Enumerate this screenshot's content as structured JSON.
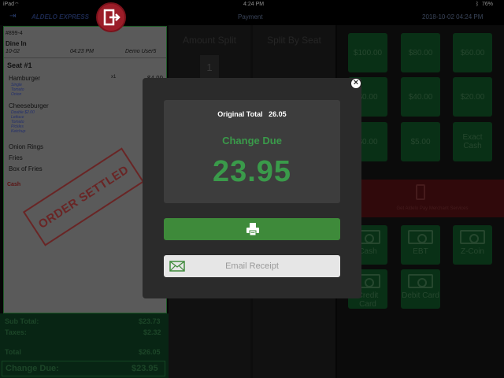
{
  "status": {
    "carrier": "iPad",
    "time": "4:24 PM",
    "battery": "76%"
  },
  "header": {
    "brand": "ALDELO EXPRESS",
    "screen_title": "Payment",
    "datetime": "2018-10-02 04:24 PM"
  },
  "ticket": {
    "order_no": "#899-4",
    "order_type": "Dine In",
    "date": "10-02",
    "time": "04:23 PM",
    "user": "Demo User5",
    "seat": "Seat #1",
    "items": [
      {
        "name": "Hamburger",
        "qty": "x1",
        "price": "$4.99",
        "mods": [
          "Single",
          "Tomato",
          "Onion"
        ]
      },
      {
        "name": "Cheeseburger",
        "qty": "",
        "price": "",
        "mods": [
          "Double $2.00",
          "Lettuce",
          "Tomato",
          "Pickles",
          "Ketchup"
        ]
      },
      {
        "name": "Onion Rings",
        "qty": "",
        "price": "",
        "mods": []
      },
      {
        "name": "Fries",
        "qty": "",
        "price": "",
        "mods": []
      },
      {
        "name": "Box of Fries",
        "qty": "",
        "price": "",
        "mods": []
      }
    ],
    "payment_method": "Cash",
    "stamp": "ORDER SETTLED"
  },
  "totals": {
    "subtotal_label": "Sub Total:",
    "subtotal": "$23.73",
    "taxes_label": "Taxes:",
    "taxes": "$2.32",
    "total_label": "Total",
    "total": "$26.05",
    "change_label": "Change Due:",
    "change": "$23.95"
  },
  "middle": {
    "amount_split": "Amount Split",
    "split_by_seat": "Split By Seat",
    "seat_number": "1"
  },
  "quick_cash": [
    "$100.00",
    "$80.00",
    "$60.00",
    "$0.00",
    "$40.00",
    "$20.00",
    "$0.00",
    "$5.00",
    "Exact Cash"
  ],
  "merchant_banner": "Get Aldelo Pay Merchant Services",
  "tenders": [
    "Cash",
    "EBT",
    "Z-Coin",
    "Credit Card",
    "Debit Card"
  ],
  "modal": {
    "original_total_label": "Original Total",
    "original_total": "26.05",
    "change_due_label": "Change Due",
    "change_due_value": "23.95",
    "email_label": "Email Receipt"
  },
  "colors": {
    "accent_green": "#3a9a4a",
    "button_green": "#3e8a3a",
    "exit_red": "#9b1d28"
  }
}
